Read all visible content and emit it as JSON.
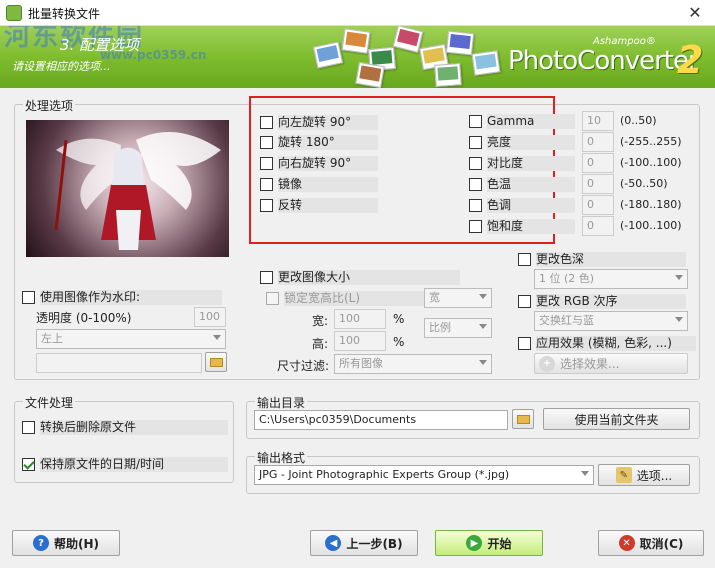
{
  "window": {
    "title": "批量转换文件",
    "close": "✕"
  },
  "banner": {
    "step": "3. 配置选项",
    "subtitle": "请设置相应的选项...",
    "brand_small": "Ashampoo®",
    "brand": "PhotoConverter",
    "brand_number": "2",
    "watermark": "河东软件园",
    "watermark_url": "www.pc0359.cn"
  },
  "processing": {
    "title": "处理选项",
    "transforms": [
      {
        "label": "向左旋转 90°",
        "checked": false
      },
      {
        "label": "旋转 180°",
        "checked": false
      },
      {
        "label": "向右旋转 90°",
        "checked": false
      },
      {
        "label": "镜像",
        "checked": false
      },
      {
        "label": "反转",
        "checked": false
      }
    ],
    "adjustments": [
      {
        "label": "Gamma",
        "value": "10",
        "range": "(0..50)"
      },
      {
        "label": "亮度",
        "value": "0",
        "range": "(-255..255)"
      },
      {
        "label": "对比度",
        "value": "0",
        "range": "(-100..100)"
      },
      {
        "label": "色温",
        "value": "0",
        "range": "(-50..50)"
      },
      {
        "label": "色调",
        "value": "0",
        "range": "(-180..180)"
      },
      {
        "label": "饱和度",
        "value": "0",
        "range": "(-100..100)"
      }
    ],
    "watermark": {
      "label": "使用图像作为水印:",
      "opacity_label": "透明度 (0-100%)",
      "opacity_value": "100",
      "position": "左上",
      "file_value": ""
    },
    "resize": {
      "label": "更改图像大小",
      "keep_ratio": "锁定宽高比(L)",
      "width_label": "宽:",
      "width_value": "100",
      "height_label": "高:",
      "height_value": "100",
      "unit": "%",
      "mode1": "宽",
      "mode2": "比例",
      "filter_label": "尺寸过滤:",
      "filter_value": "所有图像"
    },
    "color_depth": {
      "label": "更改色深",
      "value": "1 位 (2 色)"
    },
    "rgb_order": {
      "label": "更改 RGB 次序",
      "value": "交换红与蓝"
    },
    "effects": {
      "label": "应用效果 (模糊, 色彩, ...)",
      "button": "选择效果..."
    }
  },
  "file_handling": {
    "title": "文件处理",
    "delete_label": "转换后删除原文件",
    "delete_checked": false,
    "keep_date_label": "保持原文件的日期/时间",
    "keep_date_checked": true
  },
  "output_dir": {
    "title": "输出目录",
    "value": "C:\\Users\\pc0359\\Documents",
    "use_current": "使用当前文件夹"
  },
  "output_format": {
    "title": "输出格式",
    "value": "JPG - Joint Photographic Experts Group (*.jpg)",
    "options": "选项..."
  },
  "footer": {
    "help": "帮助(H)",
    "back": "上一步(B)",
    "start": "开始",
    "cancel": "取消(C)"
  },
  "colors": {
    "accent_green": "#7fbd2f",
    "highlight_red": "#e02020"
  }
}
